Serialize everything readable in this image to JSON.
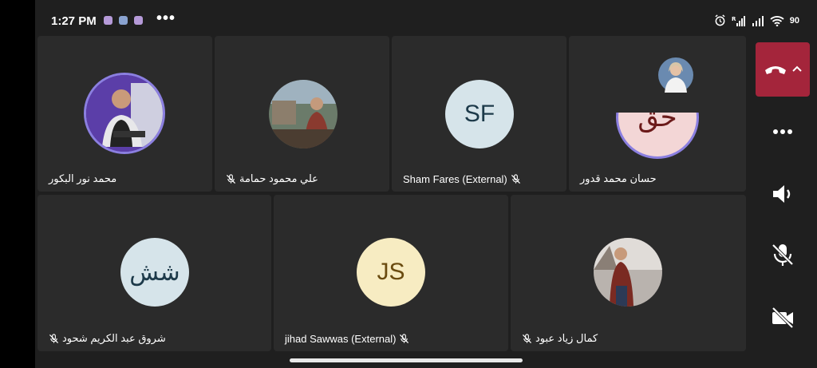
{
  "status_bar": {
    "time": "1:27 PM",
    "battery": "90",
    "notification_dots": "•••"
  },
  "participants": [
    {
      "name": "محمد نور البكور",
      "muted": false,
      "avatar_type": "photo"
    },
    {
      "name": "علي محمود حمامة",
      "muted": true,
      "avatar_type": "photo"
    },
    {
      "name": "Sham Fares (External)",
      "initials": "SF",
      "muted": true,
      "avatar_type": "initials",
      "avatar_color": "#d6e4ea",
      "initials_color": "#1d3a4a"
    },
    {
      "name": "حسان محمد قدور",
      "initials": "حق",
      "muted": false,
      "avatar_type": "initials",
      "avatar_color": "#f3d6d6",
      "initials_color": "#6b1a1a"
    },
    {
      "name": "شروق عبد الكريم شحود",
      "initials": "شش",
      "muted": true,
      "avatar_type": "initials",
      "avatar_color": "#d6e4ea",
      "initials_color": "#1d3a4a"
    },
    {
      "name": "jihad Sawwas (External)",
      "initials": "JS",
      "muted": true,
      "avatar_type": "initials",
      "avatar_color": "#f7ecc2",
      "initials_color": "#6a4b10"
    },
    {
      "name": "كمال زياد عبود",
      "muted": true,
      "avatar_type": "photo"
    }
  ],
  "controls": {
    "hangup": "phone-hangup-icon",
    "more": "more-options-icon",
    "speaker": "speaker-icon",
    "mic": "mic-off-icon",
    "camera": "camera-off-icon"
  },
  "colors": {
    "background": "#1f1f1f",
    "tile": "#2b2b2b",
    "hangup": "#a4253b",
    "speaker_ring": "#8b7fe0"
  }
}
